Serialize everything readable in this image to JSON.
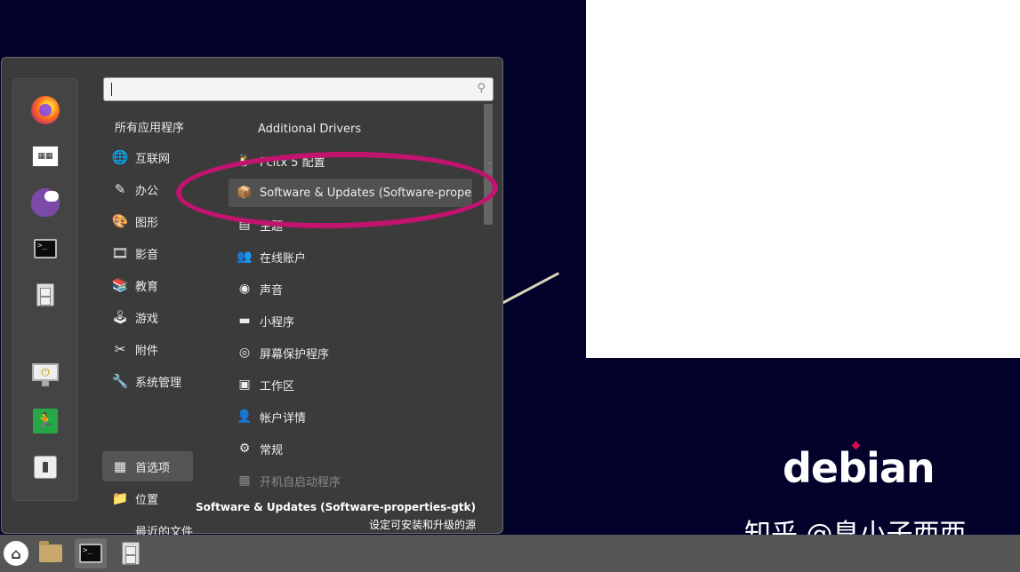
{
  "desktop": {
    "logo_text": "debian",
    "watermark": "知乎 @臭小子西西"
  },
  "menu": {
    "search": {
      "placeholder": "",
      "value": ""
    },
    "categories_header": "所有应用程序",
    "categories": [
      {
        "label": "互联网",
        "icon": "globe-icon"
      },
      {
        "label": "办公",
        "icon": "office-icon"
      },
      {
        "label": "图形",
        "icon": "palette-icon"
      },
      {
        "label": "影音",
        "icon": "film-icon"
      },
      {
        "label": "教育",
        "icon": "education-icon"
      },
      {
        "label": "游戏",
        "icon": "joystick-icon"
      },
      {
        "label": "附件",
        "icon": "tools-icon"
      },
      {
        "label": "系统管理",
        "icon": "wrench-icon"
      },
      {
        "label": "首选项",
        "icon": "preferences-icon",
        "selected": true
      },
      {
        "label": "位置",
        "icon": "folder-icon"
      },
      {
        "label": "最近的文件",
        "icon": ""
      }
    ],
    "apps": [
      {
        "label": "Additional Drivers",
        "icon": ""
      },
      {
        "label": "Fcitx 5 配置",
        "icon": "penguin-icon"
      },
      {
        "label": "Software & Updates (Software-properti…",
        "icon": "software-updates-icon",
        "highlighted": true
      },
      {
        "label": "主题",
        "icon": "theme-icon"
      },
      {
        "label": "在线账户",
        "icon": "online-accounts-icon"
      },
      {
        "label": "声音",
        "icon": "speaker-icon"
      },
      {
        "label": "小程序",
        "icon": "applet-icon"
      },
      {
        "label": "屏幕保护程序",
        "icon": "screensaver-icon"
      },
      {
        "label": "工作区",
        "icon": "workspace-icon"
      },
      {
        "label": "帐户详情",
        "icon": "user-icon"
      },
      {
        "label": "常规",
        "icon": "settings-icon"
      },
      {
        "label": "开机自启动程序",
        "icon": "startup-icon",
        "dim": true
      }
    ],
    "description": {
      "title": "Software & Updates (Software-properties-gtk)",
      "subtitle": "设定可安装和升级的源"
    }
  },
  "colors": {
    "annotation": "#c2136f",
    "desktop_bg": "#02022a",
    "panel_bg": "#3b3b3b",
    "taskbar_bg": "#555555"
  }
}
